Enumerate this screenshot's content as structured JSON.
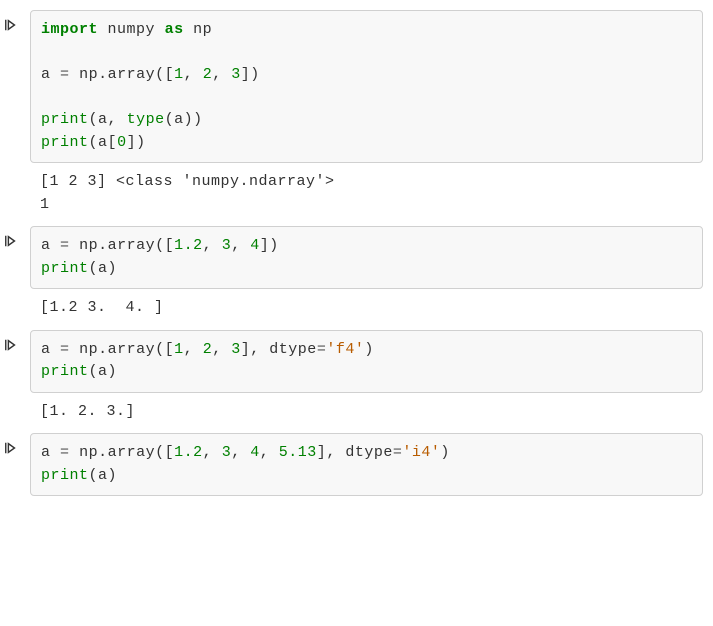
{
  "cells": [
    {
      "tokens": [
        {
          "t": "import",
          "c": "tok-kw-imp"
        },
        {
          "t": " "
        },
        {
          "t": "numpy",
          "c": "tok-name"
        },
        {
          "t": " "
        },
        {
          "t": "as",
          "c": "tok-kw-as"
        },
        {
          "t": " "
        },
        {
          "t": "np",
          "c": "tok-name"
        },
        {
          "t": "\n\n"
        },
        {
          "t": "a",
          "c": "tok-name"
        },
        {
          "t": " "
        },
        {
          "t": "=",
          "c": "tok-op"
        },
        {
          "t": " "
        },
        {
          "t": "np",
          "c": "tok-name"
        },
        {
          "t": ".",
          "c": "tok-punc"
        },
        {
          "t": "array",
          "c": "tok-name"
        },
        {
          "t": "(",
          "c": "tok-punc"
        },
        {
          "t": "[",
          "c": "tok-punc"
        },
        {
          "t": "1",
          "c": "tok-num"
        },
        {
          "t": ",",
          "c": "tok-punc"
        },
        {
          "t": " "
        },
        {
          "t": "2",
          "c": "tok-num"
        },
        {
          "t": ",",
          "c": "tok-punc"
        },
        {
          "t": " "
        },
        {
          "t": "3",
          "c": "tok-num"
        },
        {
          "t": "]",
          "c": "tok-punc"
        },
        {
          "t": ")",
          "c": "tok-punc"
        },
        {
          "t": "\n\n"
        },
        {
          "t": "print",
          "c": "tok-builtin"
        },
        {
          "t": "(",
          "c": "tok-punc"
        },
        {
          "t": "a",
          "c": "tok-name"
        },
        {
          "t": ",",
          "c": "tok-punc"
        },
        {
          "t": " "
        },
        {
          "t": "type",
          "c": "tok-builtin"
        },
        {
          "t": "(",
          "c": "tok-punc"
        },
        {
          "t": "a",
          "c": "tok-name"
        },
        {
          "t": ")",
          "c": "tok-punc"
        },
        {
          "t": ")",
          "c": "tok-punc"
        },
        {
          "t": "\n"
        },
        {
          "t": "print",
          "c": "tok-builtin"
        },
        {
          "t": "(",
          "c": "tok-punc"
        },
        {
          "t": "a",
          "c": "tok-name"
        },
        {
          "t": "[",
          "c": "tok-punc"
        },
        {
          "t": "0",
          "c": "tok-num"
        },
        {
          "t": "]",
          "c": "tok-punc"
        },
        {
          "t": ")",
          "c": "tok-punc"
        }
      ],
      "output": "[1 2 3] <class 'numpy.ndarray'>\n1"
    },
    {
      "tokens": [
        {
          "t": "a",
          "c": "tok-name"
        },
        {
          "t": " "
        },
        {
          "t": "=",
          "c": "tok-op"
        },
        {
          "t": " "
        },
        {
          "t": "np",
          "c": "tok-name"
        },
        {
          "t": ".",
          "c": "tok-punc"
        },
        {
          "t": "array",
          "c": "tok-name"
        },
        {
          "t": "(",
          "c": "tok-punc"
        },
        {
          "t": "[",
          "c": "tok-punc"
        },
        {
          "t": "1.2",
          "c": "tok-num"
        },
        {
          "t": ",",
          "c": "tok-punc"
        },
        {
          "t": " "
        },
        {
          "t": "3",
          "c": "tok-num"
        },
        {
          "t": ",",
          "c": "tok-punc"
        },
        {
          "t": " "
        },
        {
          "t": "4",
          "c": "tok-num"
        },
        {
          "t": "]",
          "c": "tok-punc"
        },
        {
          "t": ")",
          "c": "tok-punc"
        },
        {
          "t": "\n"
        },
        {
          "t": "print",
          "c": "tok-builtin"
        },
        {
          "t": "(",
          "c": "tok-punc"
        },
        {
          "t": "a",
          "c": "tok-name"
        },
        {
          "t": ")",
          "c": "tok-punc"
        }
      ],
      "output": "[1.2 3.  4. ]"
    },
    {
      "tokens": [
        {
          "t": "a",
          "c": "tok-name"
        },
        {
          "t": " "
        },
        {
          "t": "=",
          "c": "tok-op"
        },
        {
          "t": " "
        },
        {
          "t": "np",
          "c": "tok-name"
        },
        {
          "t": ".",
          "c": "tok-punc"
        },
        {
          "t": "array",
          "c": "tok-name"
        },
        {
          "t": "(",
          "c": "tok-punc"
        },
        {
          "t": "[",
          "c": "tok-punc"
        },
        {
          "t": "1",
          "c": "tok-num"
        },
        {
          "t": ",",
          "c": "tok-punc"
        },
        {
          "t": " "
        },
        {
          "t": "2",
          "c": "tok-num"
        },
        {
          "t": ",",
          "c": "tok-punc"
        },
        {
          "t": " "
        },
        {
          "t": "3",
          "c": "tok-num"
        },
        {
          "t": "]",
          "c": "tok-punc"
        },
        {
          "t": ",",
          "c": "tok-punc"
        },
        {
          "t": " "
        },
        {
          "t": "dtype",
          "c": "tok-name"
        },
        {
          "t": "=",
          "c": "tok-op"
        },
        {
          "t": "'f4'",
          "c": "tok-str"
        },
        {
          "t": ")",
          "c": "tok-punc"
        },
        {
          "t": "\n"
        },
        {
          "t": "print",
          "c": "tok-builtin"
        },
        {
          "t": "(",
          "c": "tok-punc"
        },
        {
          "t": "a",
          "c": "tok-name"
        },
        {
          "t": ")",
          "c": "tok-punc"
        }
      ],
      "output": "[1. 2. 3.]"
    },
    {
      "tokens": [
        {
          "t": "a",
          "c": "tok-name"
        },
        {
          "t": " "
        },
        {
          "t": "=",
          "c": "tok-op"
        },
        {
          "t": " "
        },
        {
          "t": "np",
          "c": "tok-name"
        },
        {
          "t": ".",
          "c": "tok-punc"
        },
        {
          "t": "array",
          "c": "tok-name"
        },
        {
          "t": "(",
          "c": "tok-punc"
        },
        {
          "t": "[",
          "c": "tok-punc"
        },
        {
          "t": "1.2",
          "c": "tok-num"
        },
        {
          "t": ",",
          "c": "tok-punc"
        },
        {
          "t": " "
        },
        {
          "t": "3",
          "c": "tok-num"
        },
        {
          "t": ",",
          "c": "tok-punc"
        },
        {
          "t": " "
        },
        {
          "t": "4",
          "c": "tok-num"
        },
        {
          "t": ",",
          "c": "tok-punc"
        },
        {
          "t": " "
        },
        {
          "t": "5.13",
          "c": "tok-num"
        },
        {
          "t": "]",
          "c": "tok-punc"
        },
        {
          "t": ",",
          "c": "tok-punc"
        },
        {
          "t": " "
        },
        {
          "t": "dtype",
          "c": "tok-name"
        },
        {
          "t": "=",
          "c": "tok-op"
        },
        {
          "t": "'i4'",
          "c": "tok-str"
        },
        {
          "t": ")",
          "c": "tok-punc"
        },
        {
          "t": "\n"
        },
        {
          "t": "print",
          "c": "tok-builtin"
        },
        {
          "t": "(",
          "c": "tok-punc"
        },
        {
          "t": "a",
          "c": "tok-name"
        },
        {
          "t": ")",
          "c": "tok-punc"
        }
      ],
      "output": ""
    }
  ]
}
